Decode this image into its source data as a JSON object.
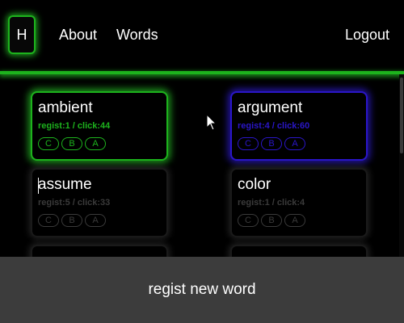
{
  "header": {
    "logo": "H",
    "nav": {
      "about": "About",
      "words": "Words",
      "logout": "Logout"
    }
  },
  "cards": [
    {
      "word": "ambient",
      "stats": "regist:1 / click:44",
      "badges": [
        "C",
        "B",
        "A"
      ],
      "state": "green"
    },
    {
      "word": "argument",
      "stats": "regist:4 / click:60",
      "badges": [
        "C",
        "B",
        "A"
      ],
      "state": "blue"
    },
    {
      "word": "assume",
      "stats": "regist:5 / click:33",
      "badges": [
        "C",
        "B",
        "A"
      ],
      "state": "gray"
    },
    {
      "word": "color",
      "stats": "regist:1 / click:4",
      "badges": [
        "C",
        "B",
        "A"
      ],
      "state": "gray"
    }
  ],
  "footer": {
    "button": "regist new word"
  },
  "colors": {
    "green": "#1db31d",
    "blue": "#2a16c8",
    "bar": "#3c3c3c"
  },
  "icons": {
    "cursor": "mouse-pointer-icon"
  }
}
